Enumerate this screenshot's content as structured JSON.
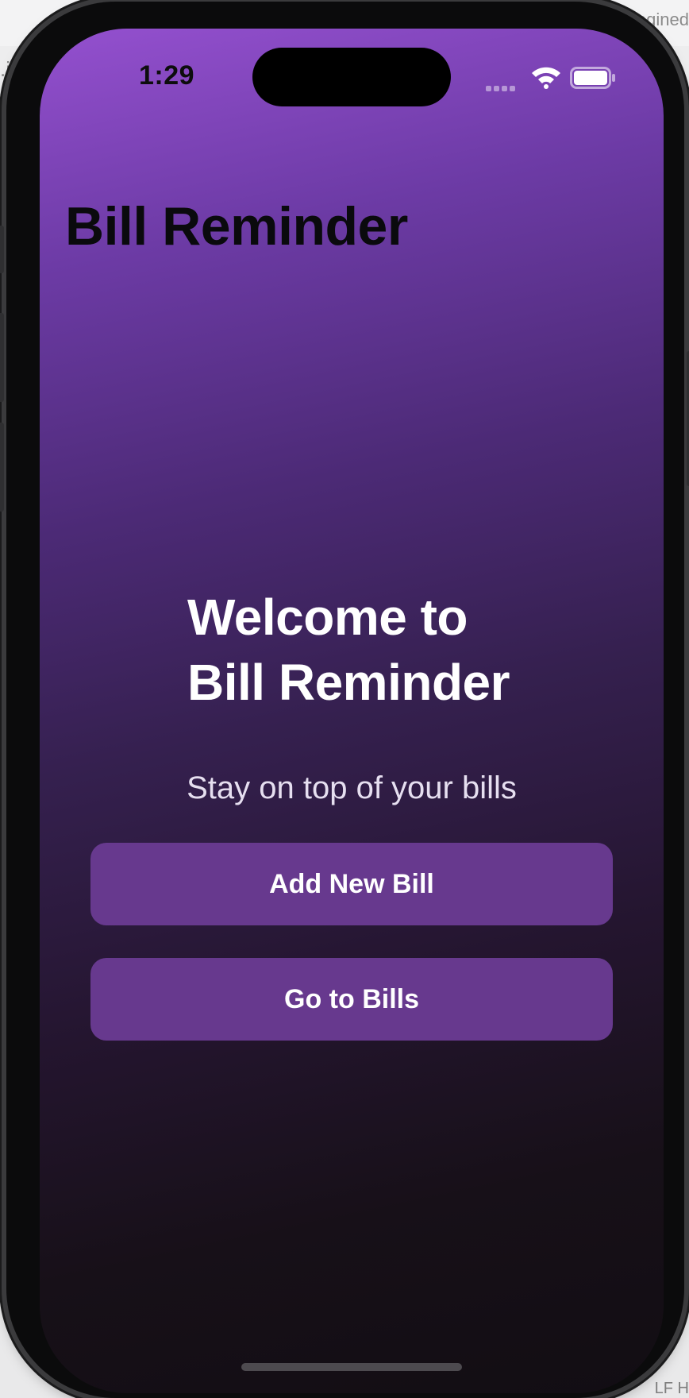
{
  "background": {
    "top_right_text": "nagined",
    "left_text": ".io",
    "bottom_right_text": "LF H"
  },
  "status_bar": {
    "time": "1:29",
    "icons": [
      "cellular-signal-icon",
      "wifi-icon",
      "battery-icon"
    ]
  },
  "nav": {
    "title": "Bill Reminder"
  },
  "main": {
    "welcome_line1": "Welcome to",
    "welcome_line2": "Bill Reminder",
    "subtitle": "Stay on top of your bills",
    "add_button_label": "Add New Bill",
    "go_button_label": "Go to Bills"
  },
  "colors": {
    "gradient_top": "#9450cf",
    "gradient_bottom": "#120d13",
    "button": "#67398e",
    "title_text": "#0a0a0d",
    "welcome_text": "#ffffff"
  }
}
